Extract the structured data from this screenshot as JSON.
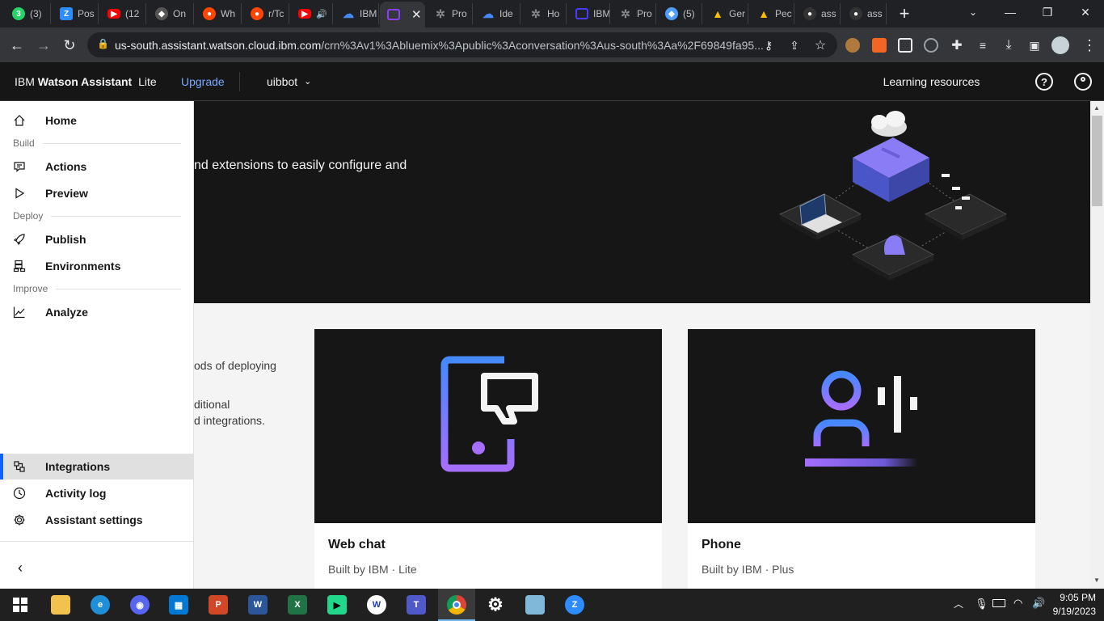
{
  "browser": {
    "tabs": [
      {
        "label": "(3)",
        "icon": "whatsapp-icon",
        "color": "#25d366"
      },
      {
        "label": "Pos",
        "icon": "zoom-icon",
        "color": "#2d8cff"
      },
      {
        "label": "(12",
        "icon": "youtube-icon",
        "color": "#ff0000"
      },
      {
        "label": "On",
        "icon": "generic-icon",
        "color": "#555555"
      },
      {
        "label": "Wh",
        "icon": "reddit-icon",
        "color": "#ff4500"
      },
      {
        "label": "r/Tc",
        "icon": "reddit-icon",
        "color": "#ff4500"
      },
      {
        "label": "",
        "icon": "youtube-icon",
        "color": "#ff0000"
      },
      {
        "label": "IBM",
        "icon": "ibm-cloud-icon",
        "color": "#4589ff"
      },
      {
        "label": "",
        "icon": "watson-icon",
        "color": "#8a3ffc"
      },
      {
        "label": "Pro",
        "icon": "openai-icon",
        "color": "#777777"
      },
      {
        "label": "Ide",
        "icon": "ibm-cloud-icon",
        "color": "#4589ff"
      },
      {
        "label": "Ho",
        "icon": "openai-icon",
        "color": "#777777"
      },
      {
        "label": "IBM",
        "icon": "watson-icon",
        "color": "#4a3bff"
      },
      {
        "label": "Pro",
        "icon": "openai-icon",
        "color": "#777777"
      },
      {
        "label": "(5)",
        "icon": "generic-icon",
        "color": "#4f9dff"
      },
      {
        "label": "Ger",
        "icon": "drive-icon",
        "color": "#fbbc04"
      },
      {
        "label": "Pec",
        "icon": "drive-icon",
        "color": "#fbbc04"
      },
      {
        "label": "ass",
        "icon": "github-icon",
        "color": "#444444"
      },
      {
        "label": "ass",
        "icon": "github-icon",
        "color": "#444444"
      }
    ],
    "url_host": "us-south.assistant.watson.cloud.ibm.com",
    "url_path": "/crn%3Av1%3Abluemix%3Apublic%3Aconversation%3Aus-south%3Aa%2F69849fa95..."
  },
  "header": {
    "brand_prefix": "IBM",
    "brand_name": "Watson Assistant",
    "plan": "Lite",
    "upgrade": "Upgrade",
    "assistant": "uibbot",
    "learning": "Learning resources"
  },
  "sidebar": {
    "home": "Home",
    "section_build": "Build",
    "actions": "Actions",
    "preview": "Preview",
    "section_deploy": "Deploy",
    "publish": "Publish",
    "environments": "Environments",
    "section_improve": "Improve",
    "analyze": "Analyze",
    "integrations": "Integrations",
    "activity_log": "Activity log",
    "assistant_settings": "Assistant settings"
  },
  "main": {
    "hero_text": "nd extensions to easily configure and",
    "side_text_1": "ods of deploying",
    "side_text_2": "ditional",
    "side_text_3": "d integrations.",
    "cards": [
      {
        "title": "Web chat",
        "sub": "Built by IBM · Lite"
      },
      {
        "title": "Phone",
        "sub": "Built by IBM · Plus"
      }
    ]
  },
  "taskbar": {
    "time": "9:05 PM",
    "date": "9/19/2023"
  }
}
